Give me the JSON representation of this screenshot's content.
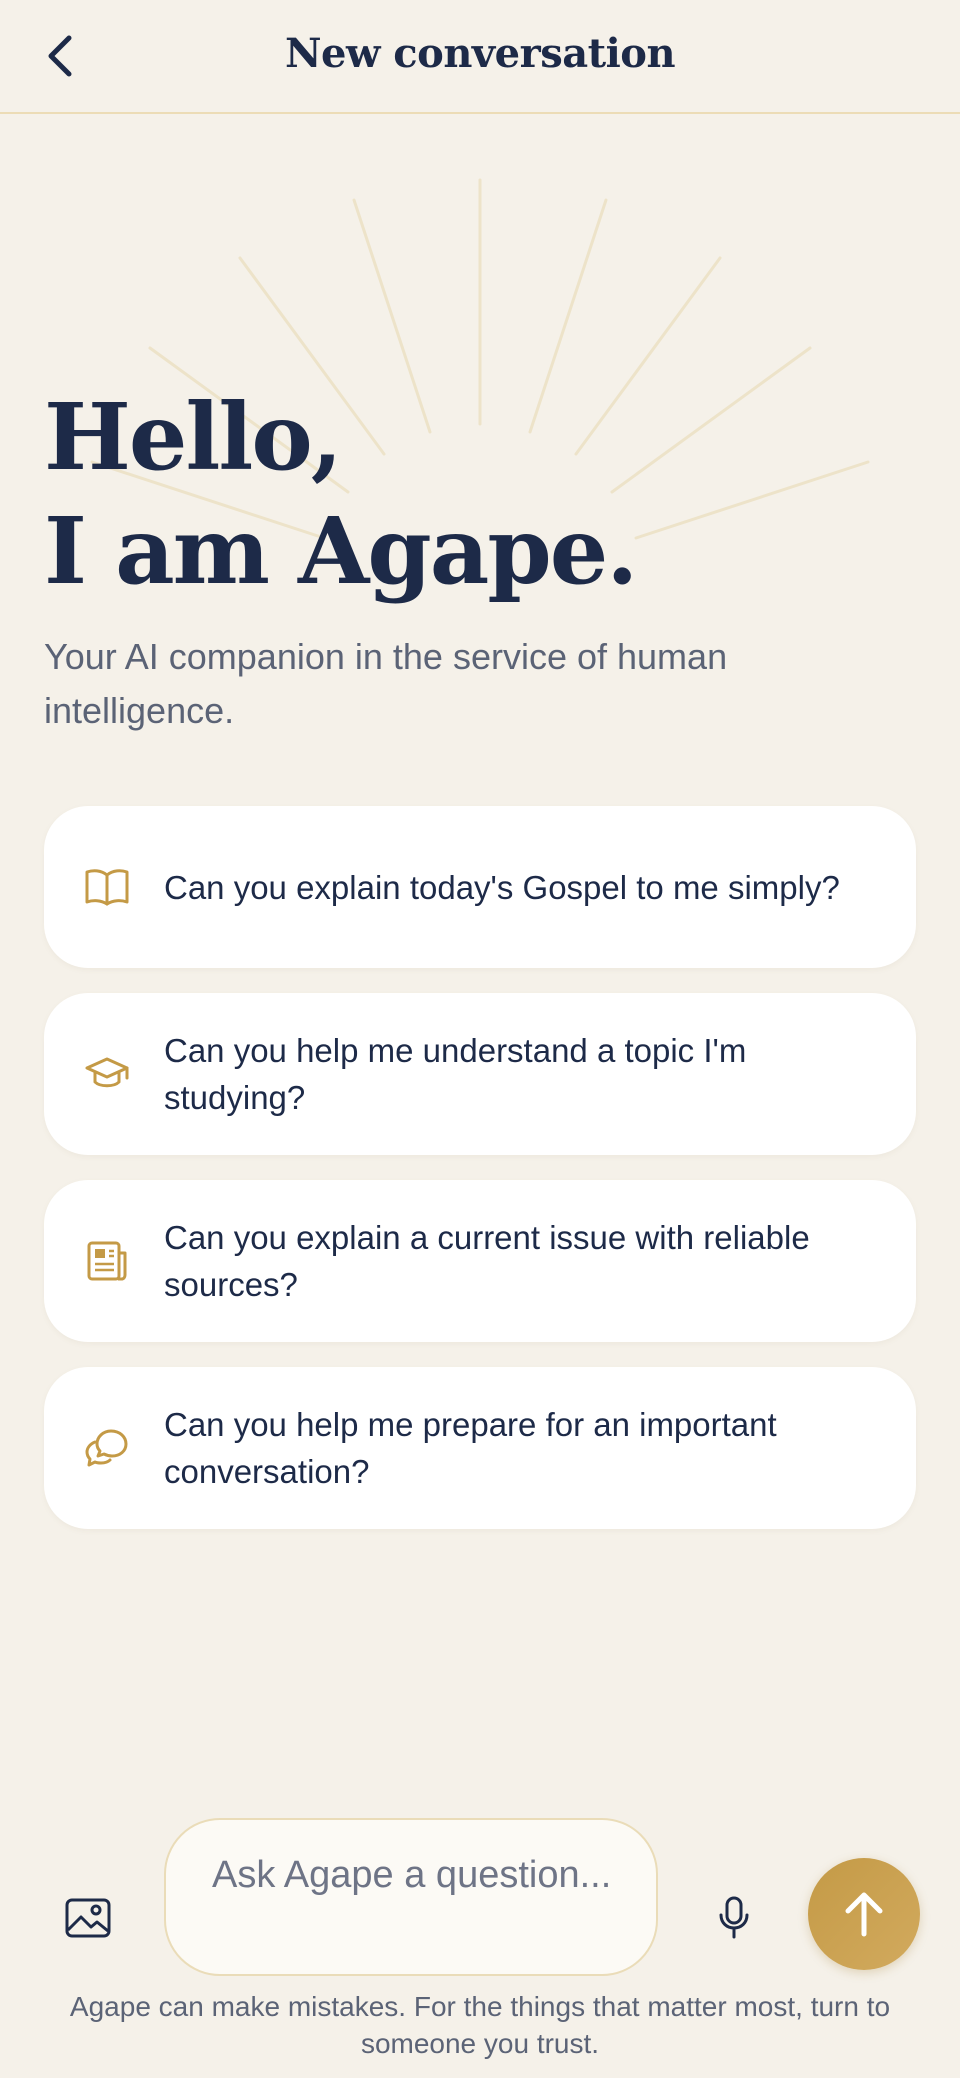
{
  "header": {
    "title": "New conversation",
    "back_icon": "chevron-left-icon"
  },
  "hero": {
    "line1": "Hello,",
    "line2": "I am Agape.",
    "subtitle": "Your AI companion in the service of human intelligence."
  },
  "suggestions": [
    {
      "icon": "open-book-icon",
      "text": "Can you explain today's Gospel to me simply?"
    },
    {
      "icon": "graduation-cap-icon",
      "text": "Can you help me understand a topic I'm studying?"
    },
    {
      "icon": "newspaper-icon",
      "text": "Can you explain a current issue with reliable sources?"
    },
    {
      "icon": "chat-bubbles-icon",
      "text": "Can you help me prepare for an important conversation?"
    }
  ],
  "composer": {
    "placeholder": "Ask Agape a question...",
    "image_icon": "image-icon",
    "mic_icon": "microphone-icon",
    "send_icon": "arrow-up-icon"
  },
  "disclaimer": "Agape can make mistakes. For the things that matter most, turn to someone you trust.",
  "colors": {
    "background": "#f5f1e9",
    "navy": "#1d2a48",
    "gold": "#c49a46",
    "card": "#ffffff"
  }
}
